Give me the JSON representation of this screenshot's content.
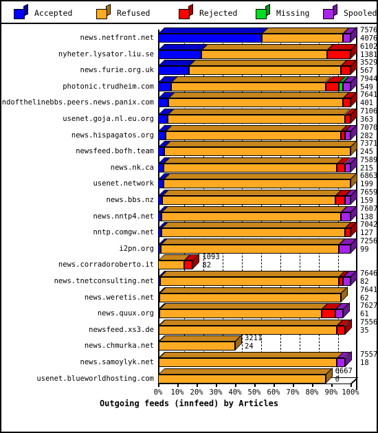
{
  "chart_data": {
    "type": "bar",
    "title": "Outgoing feeds (innfeed) by Articles",
    "xlabel": "Outgoing feeds (innfeed) by Articles",
    "ylabel": "",
    "orientation": "horizontal",
    "stacked": true,
    "units": "percent",
    "xlim": [
      0,
      100
    ],
    "grid": true,
    "legend_position": "top",
    "xticks": [
      "0%",
      "10%",
      "20%",
      "30%",
      "40%",
      "50%",
      "60%",
      "70%",
      "80%",
      "90%",
      "100%"
    ],
    "legend": [
      {
        "label": "Accepted",
        "color": "#0000ff"
      },
      {
        "label": "Refused",
        "color": "#ffaa22"
      },
      {
        "label": "Rejected",
        "color": "#ff0000"
      },
      {
        "label": "Missing",
        "color": "#00dd22"
      },
      {
        "label": "Spooled",
        "color": "#aa22ee"
      }
    ],
    "series": [
      {
        "name": "Accepted",
        "color": "#0000ff"
      },
      {
        "name": "Refused",
        "color": "#ffaa22"
      },
      {
        "name": "Rejected",
        "color": "#ff0000"
      },
      {
        "name": "Missing",
        "color": "#00dd22"
      },
      {
        "name": "Spooled",
        "color": "#aa22ee"
      }
    ],
    "categories": [
      "news.netfront.net",
      "nyheter.lysator.liu.se",
      "news.furie.org.uk",
      "photonic.trudheim.com",
      "endofthelinebbs.peers.news.panix.com",
      "usenet.goja.nl.eu.org",
      "news.hispagatos.org",
      "newsfeed.bofh.team",
      "news.nk.ca",
      "usenet.network",
      "news.bbs.nz",
      "news.nntp4.net",
      "nntp.comgw.net",
      "i2pn.org",
      "news.corradoroberto.it",
      "news.tnetconsulting.net",
      "news.weretis.net",
      "news.quux.org",
      "newsfeed.xs3.de",
      "news.chmurka.net",
      "news.samoylyk.net",
      "usenet.blueworldhosting.com"
    ],
    "rows": [
      {
        "label": "news.netfront.net",
        "total": 7576,
        "accepted": 4076,
        "pct": [
          53.8,
          42.2,
          0.0,
          0.0,
          4.0
        ],
        "label_inline": false
      },
      {
        "label": "nyheter.lysator.liu.se",
        "total": 6102,
        "accepted": 1381,
        "pct": [
          22.6,
          65.4,
          12.0,
          0.0,
          0.0
        ],
        "label_inline": true
      },
      {
        "label": "news.furie.org.uk",
        "total": 3529,
        "accepted": 567,
        "pct": [
          16.1,
          78.9,
          5.0,
          0.0,
          0.0
        ],
        "label_inline": true
      },
      {
        "label": "photonic.trudheim.com",
        "total": 7944,
        "accepted": 549,
        "pct": [
          6.9,
          80.1,
          7.0,
          2.0,
          4.0
        ],
        "label_inline": false
      },
      {
        "label": "endofthelinebbs.peers.news.panix.com",
        "total": 7641,
        "accepted": 401,
        "pct": [
          5.2,
          90.8,
          4.0,
          0.0,
          0.0
        ],
        "label_inline": false
      },
      {
        "label": "usenet.goja.nl.eu.org",
        "total": 7106,
        "accepted": 363,
        "pct": [
          5.1,
          91.9,
          3.0,
          0.0,
          0.0
        ],
        "label_inline": false
      },
      {
        "label": "news.hispagatos.org",
        "total": 7070,
        "accepted": 282,
        "pct": [
          4.0,
          91.0,
          2.0,
          0.0,
          3.0
        ],
        "label_inline": false
      },
      {
        "label": "newsfeed.bofh.team",
        "total": 7371,
        "accepted": 245,
        "pct": [
          3.3,
          96.7,
          0.0,
          0.0,
          0.0
        ],
        "label_inline": false
      },
      {
        "label": "news.nk.ca",
        "total": 7589,
        "accepted": 215,
        "pct": [
          2.8,
          90.2,
          4.0,
          0.0,
          3.0
        ],
        "label_inline": false
      },
      {
        "label": "usenet.network",
        "total": 6863,
        "accepted": 199,
        "pct": [
          2.9,
          97.1,
          0.0,
          0.0,
          0.0
        ],
        "label_inline": true
      },
      {
        "label": "news.bbs.nz",
        "total": 7659,
        "accepted": 159,
        "pct": [
          2.1,
          89.9,
          5.0,
          0.0,
          3.0
        ],
        "label_inline": false
      },
      {
        "label": "news.nntp4.net",
        "total": 7607,
        "accepted": 138,
        "pct": [
          1.8,
          93.2,
          0.0,
          0.0,
          5.0
        ],
        "label_inline": false
      },
      {
        "label": "nntp.comgw.net",
        "total": 7042,
        "accepted": 127,
        "pct": [
          1.8,
          95.2,
          3.0,
          0.0,
          0.0
        ],
        "label_inline": false
      },
      {
        "label": "i2pn.org",
        "total": 7256,
        "accepted": 99,
        "pct": [
          1.4,
          92.6,
          0.0,
          0.0,
          6.0
        ],
        "label_inline": false
      },
      {
        "label": "news.corradoroberto.it",
        "total": 1093,
        "accepted": 82,
        "pct": [
          0.0,
          13.5,
          4.5,
          0.0,
          0.0
        ],
        "label_inline": true
      },
      {
        "label": "news.tnetconsulting.net",
        "total": 7646,
        "accepted": 82,
        "pct": [
          1.1,
          92.9,
          2.0,
          0.0,
          4.0
        ],
        "label_inline": false
      },
      {
        "label": "news.weretis.net",
        "total": 7641,
        "accepted": 62,
        "pct": [
          0.8,
          94.2,
          0.0,
          0.0,
          0.0
        ],
        "label_inline": false
      },
      {
        "label": "news.quux.org",
        "total": 7627,
        "accepted": 61,
        "pct": [
          0.8,
          84.2,
          7.0,
          0.0,
          4.0
        ],
        "label_inline": false
      },
      {
        "label": "newsfeed.xs3.de",
        "total": 7556,
        "accepted": 35,
        "pct": [
          0.5,
          92.5,
          4.0,
          0.0,
          0.0
        ],
        "label_inline": false
      },
      {
        "label": "news.chmurka.net",
        "total": 3211,
        "accepted": 24,
        "pct": [
          0.3,
          39.7,
          0.0,
          0.0,
          0.0
        ],
        "label_inline": true
      },
      {
        "label": "news.samoylyk.net",
        "total": 7557,
        "accepted": 18,
        "pct": [
          0.2,
          92.8,
          0.0,
          0.0,
          4.0
        ],
        "label_inline": false
      },
      {
        "label": "usenet.blueworldhosting.com",
        "total": 6667,
        "accepted": 0,
        "pct": [
          0.0,
          87.0,
          0.0,
          0.0,
          0.0
        ],
        "label_inline": true
      }
    ]
  }
}
